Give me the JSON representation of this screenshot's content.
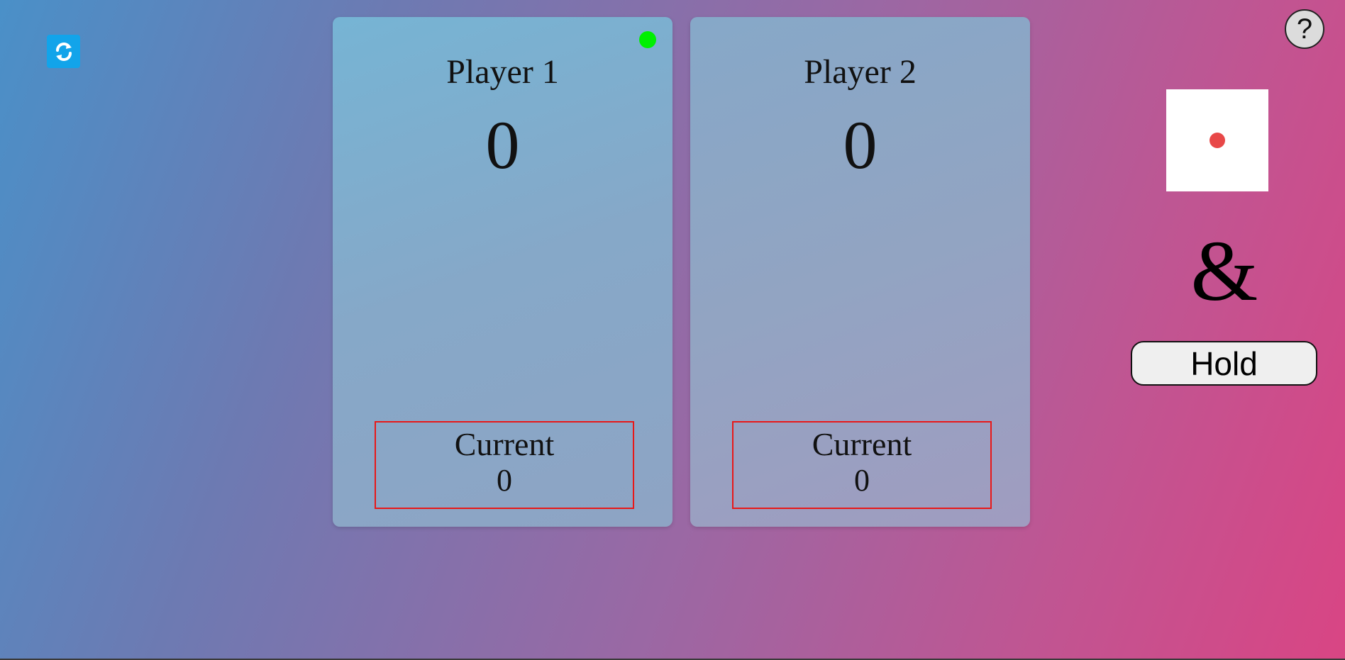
{
  "toolbar": {
    "new_game_icon": "refresh-icon",
    "help_label": "?"
  },
  "players": [
    {
      "name": "Player 1",
      "score": "0",
      "current_label": "Current",
      "current_value": "0",
      "active": true
    },
    {
      "name": "Player 2",
      "score": "0",
      "current_label": "Current",
      "current_value": "0",
      "active": false
    }
  ],
  "dice": {
    "value": 1,
    "pip_color": "#e84848"
  },
  "controls": {
    "roll_label": "&",
    "hold_label": "Hold"
  },
  "colors": {
    "active_indicator": "#00f000",
    "current_border": "#e81818",
    "refresh_button": "#12a4ea"
  }
}
